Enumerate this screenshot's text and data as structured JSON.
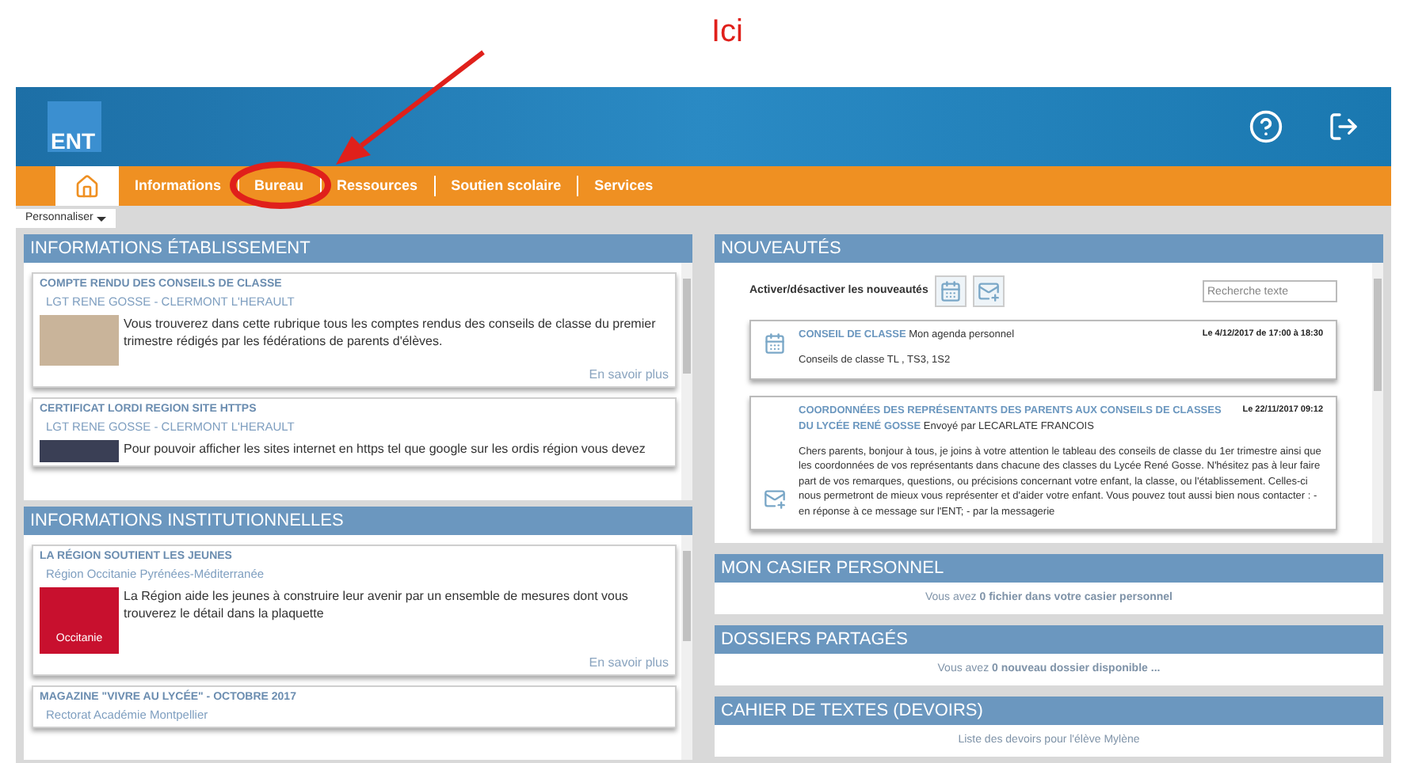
{
  "annotation": {
    "label": "Ici"
  },
  "header": {
    "logo": "ENT"
  },
  "nav": {
    "items": [
      {
        "kind": "home",
        "selected": true
      },
      {
        "kind": "link",
        "label": "Informations",
        "selected": false
      },
      {
        "kind": "link",
        "label": "Bureau",
        "selected": false
      },
      {
        "kind": "link",
        "label": "Ressources",
        "selected": false
      },
      {
        "kind": "link",
        "label": "Soutien scolaire",
        "selected": false
      },
      {
        "kind": "link",
        "label": "Services",
        "selected": false
      }
    ]
  },
  "personalize_button": "Personnaliser",
  "left_panels": [
    {
      "title": "INFORMATIONS ÉTABLISSEMENT",
      "items": [
        {
          "title": "COMPTE RENDU DES CONSEILS DE CLASSE",
          "source": "LGT RENE GOSSE - CLERMONT L'HERAULT",
          "kind": "illustration",
          "text": "Vous trouverez dans cette rubrique tous les comptes rendus des conseils de classe du premier trimestre rédigés par les fédérations de parents d'élèves.",
          "link": "En savoir plus"
        },
        {
          "title": "CERTIFICAT LORDI REGION SITE HTTPS",
          "source": "LGT RENE GOSSE - CLERMONT L'HERAULT",
          "kind": "device",
          "text": "Pour pouvoir afficher les sites internet en https tel que google sur les ordis région vous devez"
        }
      ]
    },
    {
      "title": "INFORMATIONS INSTITUTIONNELLES",
      "items": [
        {
          "title": "LA RÉGION SOUTIENT LES JEUNES",
          "source": "Région Occitanie Pyrénées-Méditerranée",
          "kind": "region-logo",
          "image_text": "Occitanie",
          "text": "La Région aide les jeunes à construire leur avenir par un ensemble de mesures dont vous trouverez le détail dans la plaquette",
          "link": "En savoir plus"
        },
        {
          "title": "MAGAZINE \"VIVRE AU LYCÉE\" - OCTOBRE 2017",
          "source": "Rectorat Académie Montpellier"
        }
      ]
    }
  ],
  "news": {
    "title": "NOUVEAUTÉS",
    "toggle_label": "Activer/désactiver les nouveautés",
    "search": {
      "placeholder": "Recherche texte"
    },
    "items": [
      {
        "kind": "event",
        "title": "CONSEIL DE CLASSE",
        "source": "Mon agenda personnel",
        "date": "Le 4/12/2017 de 17:00 à 18:30",
        "text": "Conseils de classe TL , TS3, 1S2"
      },
      {
        "kind": "message",
        "title": "COORDONNÉES DES REPRÉSENTANTS DES PARENTS AUX CONSEILS DE CLASSES DU LYCÉE RENÉ GOSSE",
        "source": "Envoyé par LECARLATE FRANCOIS",
        "date": "Le 22/11/2017 09:12",
        "text": "Chers parents, bonjour à tous, je joins à votre attention le tableau des conseils de classe du 1er trimestre ainsi que les coordonnées de vos représentants dans chacune des classes du Lycée René Gosse. N'hésitez pas à leur faire part de vos remarques, questions, ou précisions concernant votre enfant, la classe, ou l'établissement. Celles-ci nous permetront de mieux vous représenter et d'aider votre enfant. Vous pouvez tout aussi bien nous contacter : - en réponse à ce message sur l'ENT; - par la messagerie"
      }
    ]
  },
  "right_panels": [
    {
      "title": "MON CASIER PERSONNEL",
      "text": "Vous avez **0 fichier dans votre casier personnel**"
    },
    {
      "title": "DOSSIERS PARTAGÉS",
      "text": "Vous avez **0 nouveau dossier disponible ...**"
    },
    {
      "title": "CAHIER DE TEXTES (DEVOIRS)",
      "text": "Liste des devoirs pour l'élève Mylène"
    }
  ]
}
